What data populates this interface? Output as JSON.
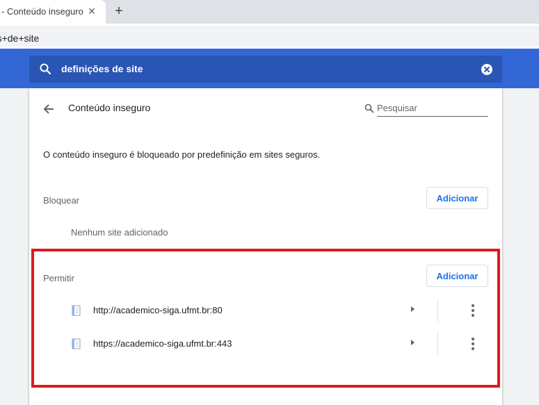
{
  "browser": {
    "tab_title": "- Conteúdo inseguro",
    "tab_close": "✕",
    "new_tab": "+",
    "address": "ões+de+site"
  },
  "header": {
    "search_value": "definições de site",
    "accent": "#3367d6"
  },
  "page": {
    "title": "Conteúdo inseguro",
    "search_placeholder": "Pesquisar",
    "description": "O conteúdo inseguro é bloqueado por predefinição em sites seguros."
  },
  "block": {
    "label": "Bloquear",
    "add_label": "Adicionar",
    "empty_text": "Nenhum site adicionado"
  },
  "allow": {
    "label": "Permitir",
    "add_label": "Adicionar",
    "sites": [
      {
        "url": "http://academico-siga.ufmt.br:80"
      },
      {
        "url": "https://academico-siga.ufmt.br:443"
      }
    ]
  },
  "highlight_color": "#e0181f"
}
